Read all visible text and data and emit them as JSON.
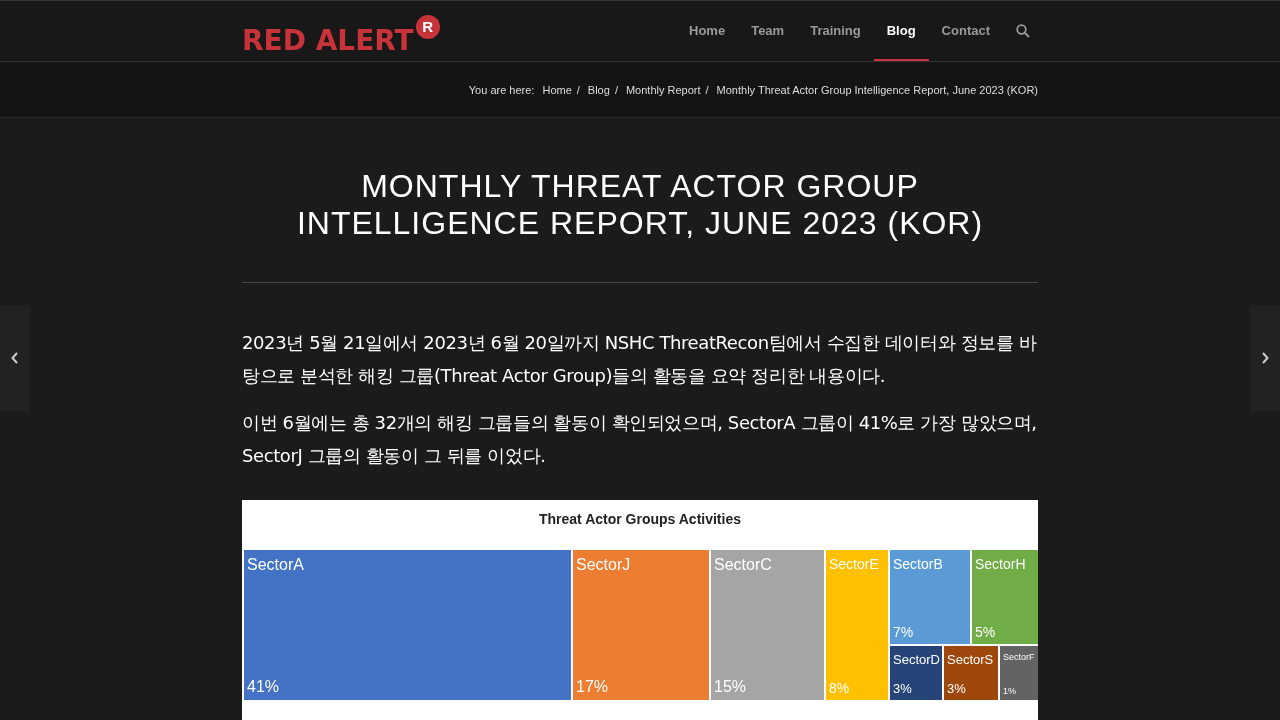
{
  "logo": {
    "text": "RED ALERT",
    "badge": "R"
  },
  "nav": [
    {
      "label": "Home",
      "selected": false
    },
    {
      "label": "Team",
      "selected": false
    },
    {
      "label": "Training",
      "selected": false
    },
    {
      "label": "Blog",
      "selected": true
    },
    {
      "label": "Contact",
      "selected": false
    }
  ],
  "breadcrumb": {
    "prefix": "You are here:",
    "links": [
      "Home",
      "Blog",
      "Monthly Report"
    ],
    "current": "Monthly Threat Actor Group Intelligence Report, June 2023 (KOR)",
    "separator": "/"
  },
  "title": "MONTHLY THREAT ACTOR GROUP INTELLIGENCE REPORT, JUNE 2023 (KOR)",
  "paragraphs": [
    "2023년 5월 21일에서 2023년 6월 20일까지 NSHC ThreatRecon팀에서 수집한 데이터와 정보를 바탕으로 분석한 해킹 그룹(Threat Actor Group)들의 활동을 요약 정리한 내용이다.",
    "이번 6월에는 총 32개의 해킹 그룹들의 활동이 확인되었으며, SectorA 그룹이 41%로 가장 많았으며, SectorJ 그룹의 활동이 그 뒤를 이었다."
  ],
  "treemap": {
    "title": "Threat Actor Groups Activities",
    "columns": [
      {
        "name": "SectorA",
        "share": "41%",
        "color": "#4472c4"
      },
      {
        "name": "SectorJ",
        "share": "17%",
        "color": "#ed7d31"
      },
      {
        "name": "SectorC",
        "share": "15%",
        "color": "#a5a5a5"
      },
      {
        "name": "SectorE",
        "share": "8%",
        "color": "#ffc000"
      }
    ],
    "top_row": [
      {
        "name": "SectorB",
        "share": "7%",
        "color": "#5b9bd5"
      },
      {
        "name": "SectorH",
        "share": "5%",
        "color": "#70ad47"
      }
    ],
    "bottom_row": [
      {
        "name": "SectorD",
        "share": "3%",
        "color": "#264478"
      },
      {
        "name": "SectorS",
        "share": "3%",
        "color": "#9e480e"
      },
      {
        "name": "SectorF",
        "share": "1%",
        "color": "#636363"
      }
    ]
  }
}
